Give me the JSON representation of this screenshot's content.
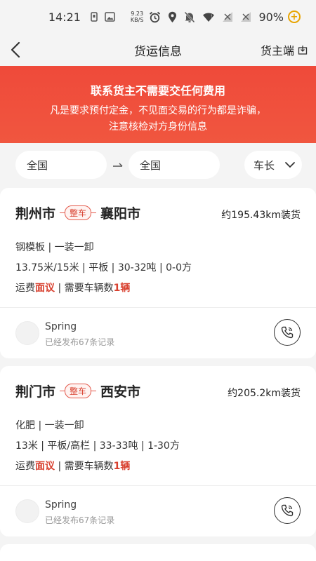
{
  "status_bar": {
    "time": "14:21",
    "net_speed_value": "9.23",
    "net_speed_unit": "KB/S",
    "battery": "90%",
    "icons": [
      "sim-icon",
      "image-icon",
      "alarm-icon",
      "location-icon",
      "mute-icon",
      "wifi-icon",
      "no-signal-icon",
      "no-signal-icon",
      "battery-saver-icon"
    ]
  },
  "header": {
    "title": "货运信息",
    "owner_link": "货主端",
    "back_icon": "chevron-left-icon",
    "owner_icon": "export-icon"
  },
  "banner": {
    "headline": "联系货主不需要交任何费用",
    "line1": "凡是要求预付定金，不见面交易的行为都是诈骗，",
    "line2": "注意核检对方身份信息",
    "color": "#ef4a3a"
  },
  "filters": {
    "from": "全国",
    "to": "全国",
    "length": "车长"
  },
  "listings": [
    {
      "from": "荆州市",
      "tag": "整车",
      "to": "襄阳市",
      "distance": "约195.43km装货",
      "goods": "钢模板 | 一装一卸",
      "specs": "13.75米/15米 | 平板 | 30-32吨 | 0-0方",
      "fee_prefix": "运费",
      "fee_highlight": "面议",
      "vehicles_prefix": " | 需要车辆数",
      "vehicles_count": "1辆",
      "user": "Spring",
      "records": "已经发布67条记录"
    },
    {
      "from": "荆门市",
      "tag": "整车",
      "to": "西安市",
      "distance": "约205.2km装货",
      "goods": "化肥 | 一装一卸",
      "specs": "13米 | 平板/高栏 | 33-33吨 | 1-30方",
      "fee_prefix": "运费",
      "fee_highlight": "面议",
      "vehicles_prefix": " | 需要车辆数",
      "vehicles_count": "1辆",
      "user": "Spring",
      "records": "已经发布67条记录"
    }
  ],
  "colors": {
    "accent_red": "#d8402f",
    "background": "#f4f4f4"
  }
}
